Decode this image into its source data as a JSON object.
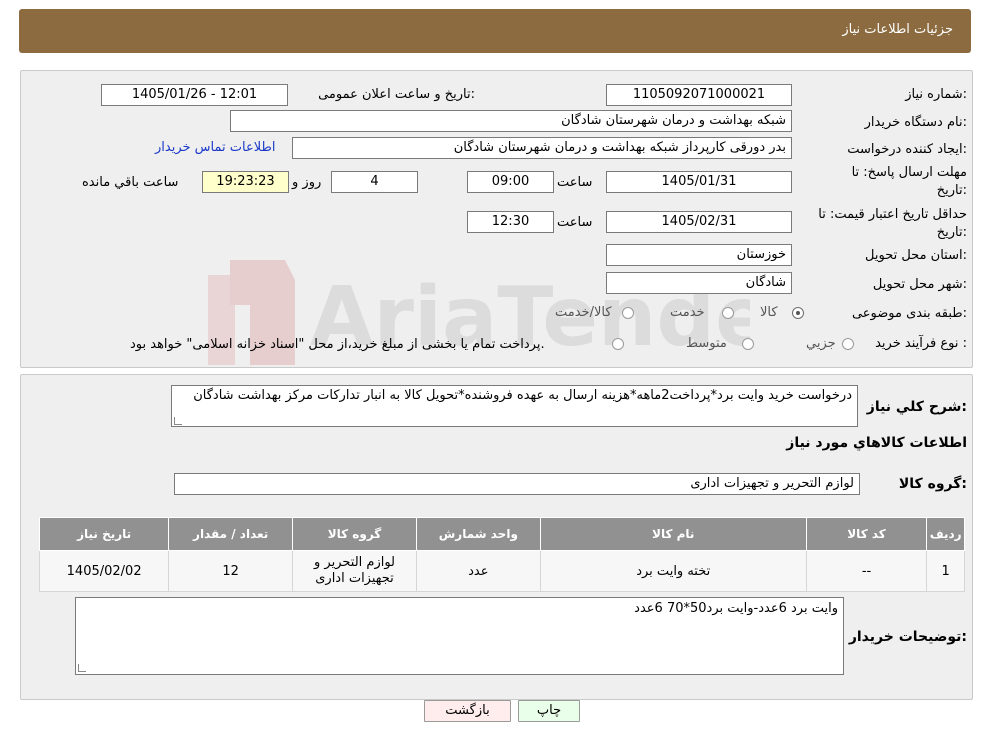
{
  "header": {
    "title": "جزئیات اطلاعات نیاز"
  },
  "form": {
    "need_number_label": "شماره نیاز:",
    "need_number": "1105092071000021",
    "announce_label": "تاریخ و ساعت اعلان عمومی:",
    "announce_value": "1405/01/26 - 12:01",
    "buyer_org_label": "نام دستگاه خریدار:",
    "buyer_org": "شبکه بهداشت و درمان شهرستان شادگان",
    "creator_label": "ایجاد کننده درخواست:",
    "creator": "بدر دورقی کارپرداز شبکه بهداشت و درمان شهرستان شادگان",
    "contact_link": "اطلاعات تماس خریدار",
    "reply_deadline_label_1": "مهلت ارسال پاسخ: تا",
    "reply_deadline_label_2": "تاریخ:",
    "reply_date": "1405/01/31",
    "time_label": "ساعت",
    "reply_time": "09:00",
    "days_value": "4",
    "days_label": "روز و",
    "remaining_time": "19:23:23",
    "remaining_label": "ساعت باقي مانده",
    "validity_label_1": "حداقل تاریخ اعتبار قیمت: تا",
    "validity_label_2": "تاریخ:",
    "validity_date": "1405/02/31",
    "validity_time": "12:30",
    "province_label": "استان محل تحویل:",
    "province": "خوزستان",
    "city_label": "شهر محل تحویل:",
    "city": "شادگان",
    "category_label": "طبقه بندی موضوعی:",
    "category_options": [
      "کالا",
      "خدمت",
      "کالا/خدمت"
    ],
    "category_selected": "کالا",
    "process_label": "نوع فرآیند خرید :",
    "process_options": [
      "جزیي",
      "متوسط"
    ],
    "process_note": "پرداخت تمام یا بخشی از مبلغ خرید،از محل \"اسناد خزانه اسلامی\" خواهد بود."
  },
  "description": {
    "label": "شرح کلي نياز:",
    "text": "درخواست خرید وایت برد*پرداخت2ماهه*هزینه ارسال به عهده فروشنده*تحویل کالا به انبار تدارکات مرکز بهداشت شادگان"
  },
  "goods": {
    "section_title": "اطلاعات کالاهاي مورد نياز",
    "group_label": "گروه کالا:",
    "group_value": "لوازم التحریر و تجهیزات اداری",
    "columns": [
      "رديف",
      "کد کالا",
      "نام کالا",
      "واحد شمارش",
      "گروه کالا",
      "تعداد / مقدار",
      "تاریخ نیاز"
    ],
    "rows": [
      {
        "index": "1",
        "code": "--",
        "name": "تخته وایت برد",
        "unit": "عدد",
        "group": "لوازم التحریر و تجهیزات اداری",
        "qty": "12",
        "date": "1405/02/02"
      }
    ]
  },
  "buyer_notes": {
    "label": "توضیحات خریدار:",
    "text": "وایت برد 6عدد-وایت برد50*70 6عدد"
  },
  "buttons": {
    "print": "چاپ",
    "back": "بازگشت"
  },
  "watermark": "AriaTender.neT",
  "colors": {
    "header": "#8b6b3f",
    "link": "#1a39c9",
    "table_header": "#919191",
    "highlight": "#ffffcc"
  }
}
